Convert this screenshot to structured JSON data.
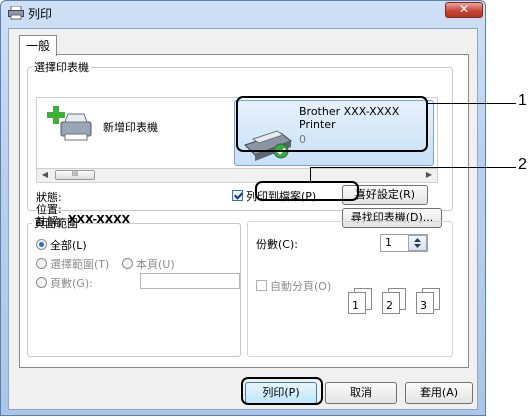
{
  "window": {
    "title": "列印",
    "close_label": "✕"
  },
  "tabs": [
    {
      "label": "一般",
      "active": true
    }
  ],
  "select_printer": {
    "group_label": "選擇印表機",
    "add_printer_label": "新增印表機",
    "printer": {
      "name_line1": "Brother XXX-XXXX",
      "name_line2": "Printer",
      "queue_count": "0",
      "selected": true
    },
    "scroll_thumb_glyph": "III"
  },
  "status": {
    "status_label": "狀態:",
    "location_label": "位置:",
    "comment_label": "註解:",
    "comment_value": "XXX-XXXX",
    "print_to_file_label": "列印到檔案(P)",
    "print_to_file_checked": true,
    "preferences_button": "喜好設定(R)",
    "find_printer_button": "尋找印表機(D)..."
  },
  "page_range": {
    "group_label": "頁面範圍",
    "all_label": "全部(L)",
    "selection_label": "選擇範圍(T)",
    "current_page_label": "本頁(U)",
    "pages_label": "頁數(G):",
    "selected_option": "all"
  },
  "copies": {
    "label": "份數(C):",
    "value": "1",
    "collate_label": "自動分頁(O)",
    "collate_checked": false,
    "collate_pages": [
      "1",
      "2",
      "3"
    ]
  },
  "footer": {
    "print_button": "列印(P)",
    "cancel_button": "取消",
    "apply_button": "套用(A)"
  },
  "callouts": [
    "1",
    "2"
  ],
  "colors": {
    "title_gradient_top": "#cfe0f4",
    "close_red": "#c9483b",
    "selection_blue": "#c8e0f7",
    "radio_blue": "#2b6fcf"
  }
}
